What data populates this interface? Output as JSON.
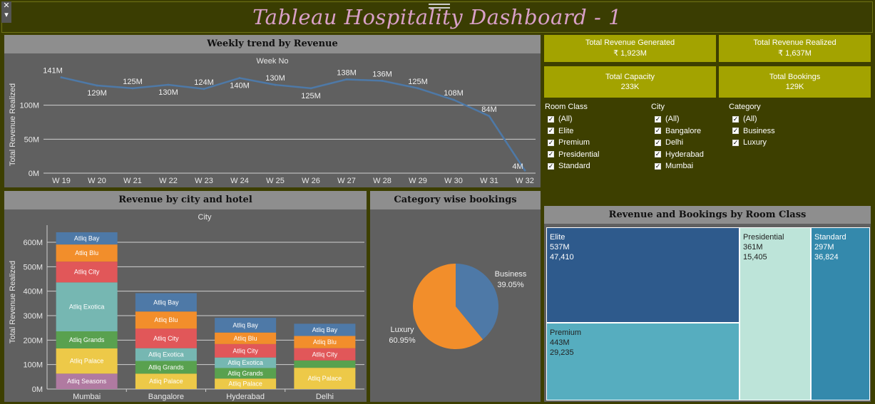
{
  "dashboard": {
    "title": "Tableau Hospitality Dashboard  - 1"
  },
  "window_controls": {
    "close": "✕",
    "menu": "▾"
  },
  "weekly": {
    "panel_title": "Weekly trend by Revenue",
    "x_header": "Week No",
    "y_label": "Total Revenue Realized"
  },
  "city_hotel": {
    "panel_title": "Revenue by city and hotel",
    "x_header": "City",
    "y_label": "Total Revenue Realized"
  },
  "category": {
    "panel_title": "Category wise bookings"
  },
  "room_class": {
    "panel_title": "Revenue and Bookings by Room Class",
    "cells": [
      {
        "name": "Elite",
        "revenue": "537M",
        "bookings": "47,410",
        "color": "#2e5a8c",
        "text_color": "#ffffff"
      },
      {
        "name": "Premium",
        "revenue": "443M",
        "bookings": "29,235",
        "color": "#56adbf",
        "text_color": "#222222"
      },
      {
        "name": "Presidential",
        "revenue": "361M",
        "bookings": "15,405",
        "color": "#bde4d9",
        "text_color": "#222222"
      },
      {
        "name": "Standard",
        "revenue": "297M",
        "bookings": "36,824",
        "color": "#3489ac",
        "text_color": "#ffffff"
      }
    ]
  },
  "kpis": [
    {
      "title": "Total Revenue Generated",
      "value": "₹ 1,923M"
    },
    {
      "title": "Total Revenue Realized",
      "value": "₹ 1,637M"
    },
    {
      "title": "Total Capacity",
      "value": "233K"
    },
    {
      "title": "Total Bookings",
      "value": "129K"
    }
  ],
  "filters": [
    {
      "title": "Room Class",
      "options": [
        "(All)",
        "Elite",
        "Premium",
        "Presidential",
        "Standard"
      ]
    },
    {
      "title": "City",
      "options": [
        "(All)",
        "Bangalore",
        "Delhi",
        "Hyderabad",
        "Mumbai"
      ]
    },
    {
      "title": "Category",
      "options": [
        "(All)",
        "Business",
        "Luxury"
      ]
    }
  ],
  "colors": {
    "background": "#3d3f00",
    "panel": "#606060",
    "panel_header": "#8e8e8e",
    "kpi": "#a3a300",
    "line": "#4e79a7"
  },
  "chart_data": [
    {
      "type": "line",
      "title": "Weekly trend by Revenue",
      "xlabel": "Week No",
      "ylabel": "Total Revenue Realized",
      "categories": [
        "W 19",
        "W 20",
        "W 21",
        "W 22",
        "W 23",
        "W 24",
        "W 25",
        "W 26",
        "W 27",
        "W 28",
        "W 29",
        "W 30",
        "W 31",
        "W 32"
      ],
      "values": [
        141,
        129,
        125,
        130,
        124,
        140,
        130,
        125,
        138,
        136,
        125,
        108,
        84,
        4
      ],
      "data_labels": [
        "141M",
        "129M",
        "125M",
        "130M",
        "124M",
        "140M",
        "130M",
        "125M",
        "138M",
        "136M",
        "125M",
        "108M",
        "84M",
        "4M"
      ],
      "y_ticks": [
        "0M",
        "50M",
        "100M"
      ],
      "ylim": [
        0,
        150
      ],
      "grid": true
    },
    {
      "type": "bar",
      "stacked": true,
      "title": "Revenue by city and hotel",
      "xlabel": "City",
      "ylabel": "Total Revenue Realized",
      "categories": [
        "Mumbai",
        "Bangalore",
        "Hyderabad",
        "Delhi"
      ],
      "y_ticks": [
        "0M",
        "100M",
        "200M",
        "300M",
        "400M",
        "500M",
        "600M"
      ],
      "ylim": [
        0,
        670
      ],
      "grid": true,
      "series": [
        {
          "name": "Atliq Seasons",
          "color": "#b07aa1",
          "values": [
            63,
            0,
            0,
            0
          ]
        },
        {
          "name": "Atliq Palace",
          "color": "#edc948",
          "values": [
            103,
            63,
            43,
            87
          ]
        },
        {
          "name": "Atliq Grands",
          "color": "#59a14f",
          "values": [
            70,
            52,
            43,
            30
          ]
        },
        {
          "name": "Atliq Exotica",
          "color": "#76b7b2",
          "values": [
            200,
            52,
            43,
            0
          ]
        },
        {
          "name": "Atliq City",
          "color": "#e15759",
          "values": [
            85,
            80,
            55,
            50
          ]
        },
        {
          "name": "Atliq Blu",
          "color": "#f28e2b",
          "values": [
            70,
            70,
            47,
            50
          ]
        },
        {
          "name": "Atliq Bay",
          "color": "#4e79a7",
          "values": [
            50,
            75,
            60,
            50
          ]
        }
      ]
    },
    {
      "type": "pie",
      "title": "Category wise bookings",
      "labels": [
        "Business",
        "Luxury"
      ],
      "values": [
        39.05,
        60.95
      ],
      "value_labels": [
        "39.05%",
        "60.95%"
      ],
      "colors": [
        "#4e79a7",
        "#f28e2b"
      ]
    }
  ]
}
